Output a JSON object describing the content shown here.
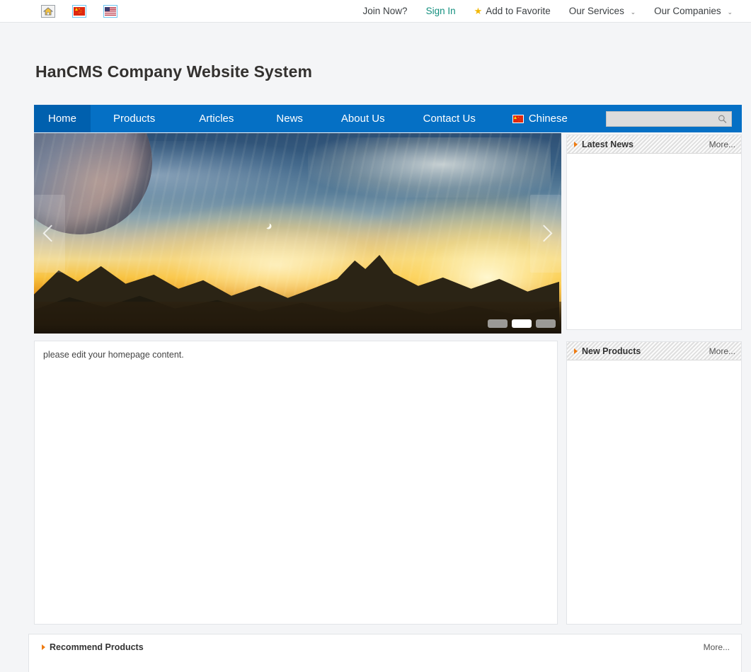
{
  "topbar": {
    "icons": [
      {
        "name": "home-icon",
        "label": "Home"
      },
      {
        "name": "flag-china-icon",
        "label": "Chinese"
      },
      {
        "name": "flag-usa-icon",
        "label": "English"
      }
    ],
    "links": {
      "join": "Join Now?",
      "signin": "Sign In",
      "favorite": "Add to Favorite",
      "services": "Our Services",
      "companies": "Our Companies",
      "caret": "⌄",
      "star": "★"
    }
  },
  "site": {
    "title": "HanCMS Company Website System"
  },
  "nav": {
    "items": [
      {
        "label": "Home",
        "active": true
      },
      {
        "label": "Products",
        "active": false
      },
      {
        "label": "Articles",
        "active": false
      },
      {
        "label": "News",
        "active": false
      },
      {
        "label": "About Us",
        "active": false
      },
      {
        "label": "Contact Us",
        "active": false
      },
      {
        "label": "Chinese",
        "active": false
      }
    ]
  },
  "search": {
    "value": "",
    "placeholder": ""
  },
  "hero": {
    "prev_label": "Previous slide",
    "next_label": "Next slide",
    "slides": [
      {
        "index": 1,
        "active": false
      },
      {
        "index": 2,
        "active": true
      },
      {
        "index": 3,
        "active": false
      }
    ]
  },
  "main": {
    "content_text": "please edit your homepage content."
  },
  "sidebar": {
    "latest_news": {
      "title": "Latest News",
      "more": "More..."
    },
    "new_products": {
      "title": "New Products",
      "more": "More..."
    }
  },
  "recommend": {
    "title": "Recommend Products",
    "more": "More..."
  },
  "colors": {
    "nav_blue": "#0570c5",
    "nav_active_blue": "#0060ae",
    "accent_orange": "#ef7c12",
    "signin_teal": "#14907f",
    "page_bg": "#f4f5f7"
  }
}
